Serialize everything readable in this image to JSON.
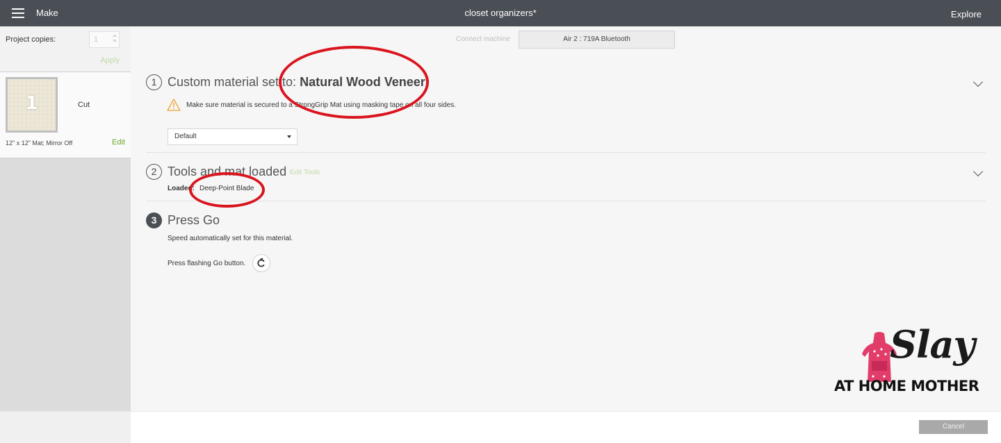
{
  "topbar": {
    "app_name": "Make",
    "document_title": "closet organizers*",
    "explore_label": "Explore"
  },
  "sidebar": {
    "project_copies_label": "Project copies:",
    "project_copies_value": "1",
    "apply_label": "Apply",
    "mat": {
      "number": "1",
      "action": "Cut",
      "description": "12\" x 12\" Mat; Mirror Off",
      "edit_label": "Edit"
    }
  },
  "connect": {
    "label": "Connect machine",
    "machine": "Air 2 : 719A Bluetooth"
  },
  "steps": {
    "step1": {
      "number": "1",
      "title_prefix": "Custom material set to: ",
      "material": "Natural Wood Veneer",
      "warning": "Make sure material is secured to a StrongGrip Mat using masking tape on all four sides.",
      "material_option": "Default"
    },
    "step2": {
      "number": "2",
      "title": "Tools and mat loaded",
      "edit_tools_label": "Edit Tools",
      "loaded_label": "Loaded:",
      "loaded_value": "Deep-Point Blade"
    },
    "step3": {
      "number": "3",
      "title": "Press Go",
      "speed_text": "Speed automatically set for this material.",
      "press_text": "Press flashing Go button."
    }
  },
  "footer": {
    "cancel_label": "Cancel"
  },
  "watermark": {
    "brand": "Slay",
    "subtitle": "AT HOME MOTHER"
  },
  "colors": {
    "topbar": "#4a4e55",
    "accent_green": "#6aaa2e",
    "highlight_red": "#d9141e",
    "warning_orange": "#f0a030"
  },
  "icons": {
    "menu": "hamburger-icon",
    "warning": "warning-icon",
    "go": "go-icon",
    "expand": "chevron-down-icon"
  }
}
